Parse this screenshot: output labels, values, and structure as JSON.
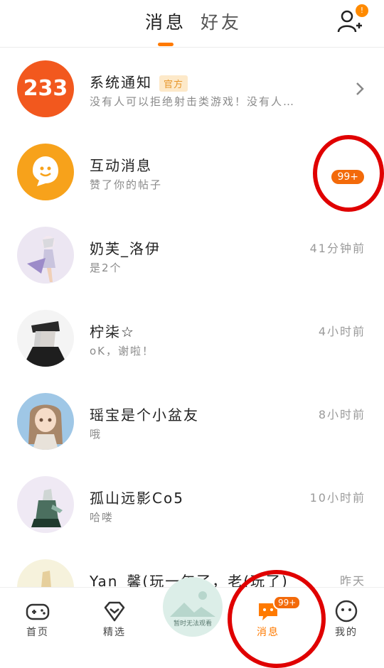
{
  "header": {
    "tab_messages": "消息",
    "tab_friends": "好友",
    "add_friend_badge": "!"
  },
  "conversations": [
    {
      "name": "系统通知",
      "tag": "官方",
      "preview": "没有人可以拒绝射击类游戏！没有人…",
      "time": "",
      "avatar_text": "233"
    },
    {
      "name": "互动消息",
      "preview": "赞了你的帖子",
      "badge": "99+"
    },
    {
      "name": "奶芙_洛伊",
      "preview": "是2个",
      "time": "41分钟前"
    },
    {
      "name": "柠柒☆",
      "preview": "oK，谢啦！",
      "time": "4小时前"
    },
    {
      "name": "瑶宝是个小盆友",
      "preview": "哦",
      "time": "8小时前"
    },
    {
      "name": "孤山远影Co5",
      "preview": "哈喽",
      "time": "10小时前"
    },
    {
      "name": "Yan_馨(玩一年了，老(玩了)",
      "preview": "",
      "time": "昨天"
    }
  ],
  "bottom_nav": {
    "home": "首页",
    "featured": "精选",
    "video_placeholder": "暂时无法观看",
    "messages": "消息",
    "messages_badge": "99+",
    "mine": "我的"
  },
  "colors": {
    "accent": "#ff7a00",
    "badge": "#f36a0a",
    "annotation": "#e00000"
  }
}
